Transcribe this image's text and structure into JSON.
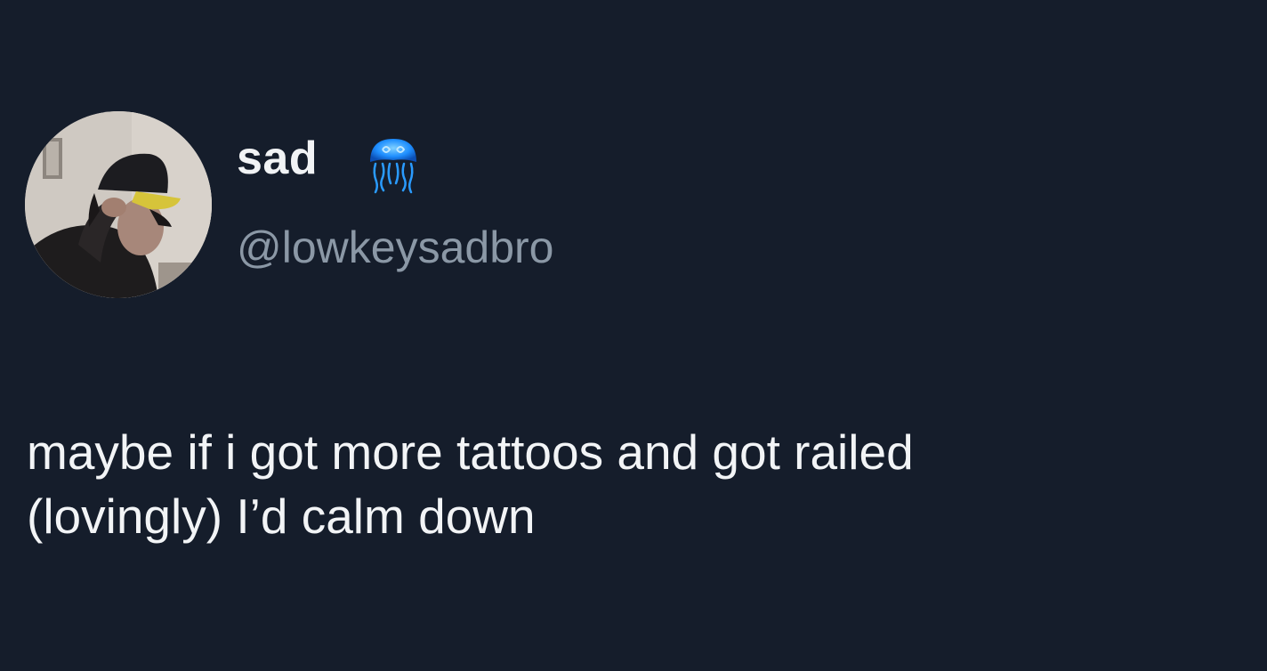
{
  "author": {
    "display_name": "sad",
    "handle": "@lowkeysadbro",
    "badge_icon": "jellyfish-icon",
    "avatar_icon": "profile-photo"
  },
  "tweet": {
    "lines": [
      "maybe if i got more tattoos and got railed",
      "(lovingly) I’d calm down"
    ]
  },
  "colors": {
    "background": "#151d2b",
    "text_primary": "#f2f4f6",
    "text_secondary": "#8b98a6",
    "badge_blue": "#1f8fff"
  }
}
